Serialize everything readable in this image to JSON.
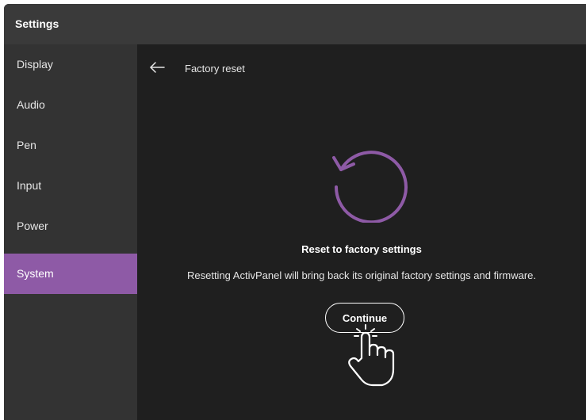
{
  "window": {
    "title": "Settings"
  },
  "sidebar": {
    "items": [
      {
        "label": "Display",
        "active": false
      },
      {
        "label": "Audio",
        "active": false
      },
      {
        "label": "Pen",
        "active": false
      },
      {
        "label": "Input",
        "active": false
      },
      {
        "label": "Power",
        "active": false
      },
      {
        "label": "System",
        "active": true
      }
    ]
  },
  "content": {
    "title": "Factory reset",
    "heading": "Reset to factory settings",
    "description": "Resetting ActivPanel will bring back its original factory settings and firmware.",
    "continue_label": "Continue"
  },
  "icons": {
    "back": "arrow-left-icon",
    "reset": "reset-arrow-icon",
    "cursor": "hand-pointer-icon"
  },
  "colors": {
    "accent": "#8e5aa6",
    "titlebar": "#3a3a3a",
    "sidebar": "#333333",
    "content": "#1f1f1f"
  }
}
